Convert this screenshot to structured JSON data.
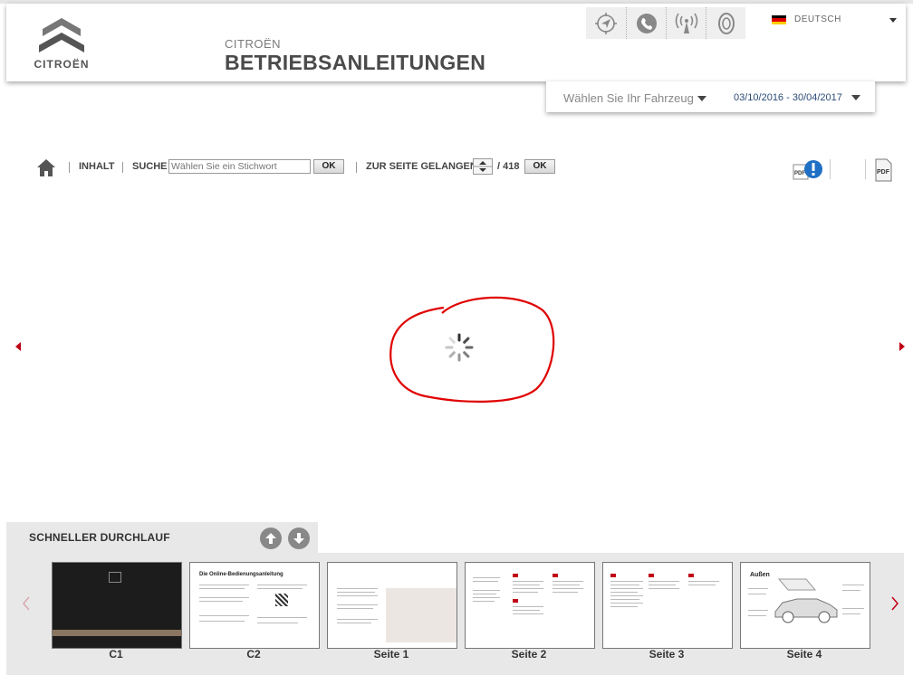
{
  "header": {
    "logo_text": "CITROËN",
    "brand_sub": "CITROËN",
    "title": "BETRIEBSANLEITUNGEN"
  },
  "tools": [
    {
      "icon": "navigation-icon"
    },
    {
      "icon": "phone-icon"
    },
    {
      "icon": "connectivity-icon"
    },
    {
      "icon": "tire-icon"
    }
  ],
  "language": {
    "label": "DEUTSCH",
    "flag_colors": [
      "#000000",
      "#dd0000",
      "#ffce00"
    ]
  },
  "vehicle": {
    "placeholder": "Wählen Sie Ihr Fahrzeug",
    "date_range": "03/10/2016 - 30/04/2017"
  },
  "nav": {
    "home_icon": "home-icon",
    "contents": "INHALT",
    "search_label": "SUCHE",
    "search_placeholder": "Wählen Sie ein Stichwort",
    "ok": "OK",
    "goto_label": "ZUR SEITE GELANGEN",
    "total_pages": "/ 418",
    "ok2": "OK"
  },
  "quick_scroll": {
    "title": "SCHNELLER DURCHLAUF"
  },
  "thumbnails": [
    {
      "label": "C1"
    },
    {
      "label": "C2",
      "heading": "Die Online-Bedienungsanleitung"
    },
    {
      "label": "Seite 1"
    },
    {
      "label": "Seite 2"
    },
    {
      "label": "Seite 3"
    },
    {
      "label": "Seite 4",
      "heading": "Außen"
    }
  ],
  "colors": {
    "accent": "#c00016",
    "annotation": "#e00000",
    "date_blue": "#2c4a78"
  }
}
